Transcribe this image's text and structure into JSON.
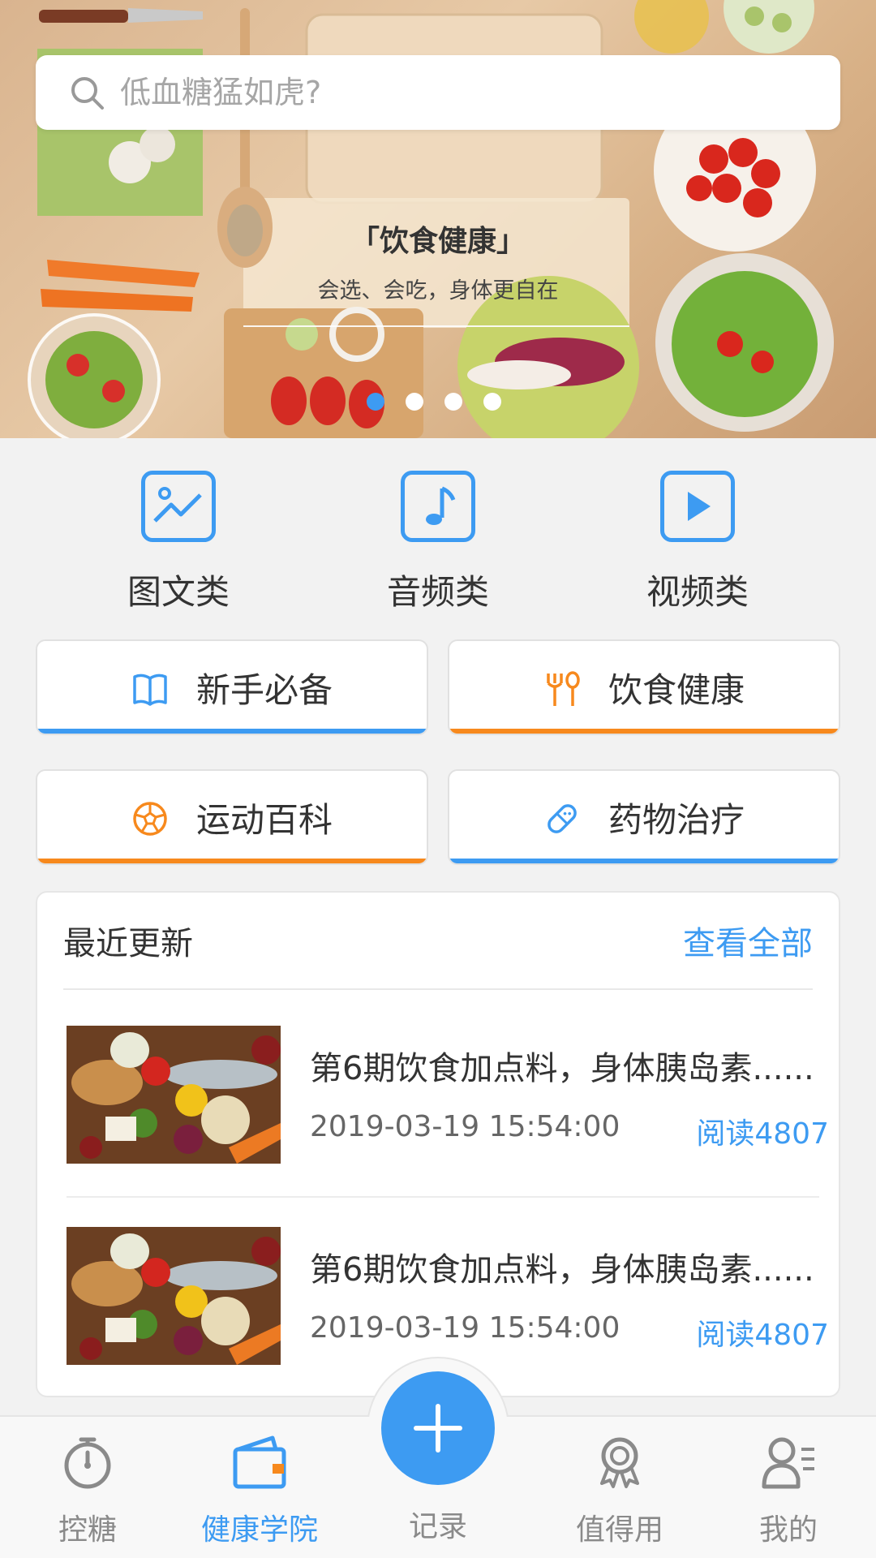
{
  "search": {
    "placeholder": "低血糖猛如虎?"
  },
  "banner": {
    "title": "「饮食健康」",
    "subtitle": "会选、会吃，身体更自在",
    "dots": 4,
    "active_dot": 0
  },
  "categories": [
    {
      "label": "图文类",
      "icon": "image-chart-icon"
    },
    {
      "label": "音频类",
      "icon": "music-note-icon"
    },
    {
      "label": "视频类",
      "icon": "play-icon"
    }
  ],
  "tiles": [
    {
      "label": "新手必备",
      "icon": "book-icon",
      "accent": "#3d9bf2"
    },
    {
      "label": "饮食健康",
      "icon": "fork-spoon-icon",
      "accent": "#f7891d"
    },
    {
      "label": "运动百科",
      "icon": "ball-icon",
      "accent": "#f7891d"
    },
    {
      "label": "药物治疗",
      "icon": "pill-icon",
      "accent": "#3d9bf2"
    }
  ],
  "recent": {
    "title": "最近更新",
    "more": "查看全部",
    "items": [
      {
        "title": "第6期饮食加点料，身体胰岛素......",
        "date": "2019-03-19  15:54:00",
        "reads": "阅读4807"
      },
      {
        "title": "第6期饮食加点料，身体胰岛素......",
        "date": "2019-03-19  15:54:00",
        "reads": "阅读4807"
      }
    ]
  },
  "nav": {
    "items": [
      {
        "label": "控糖",
        "icon": "stopwatch-icon"
      },
      {
        "label": "健康学院",
        "icon": "wallet-icon",
        "active": true
      },
      {
        "label": "记录",
        "icon": "plus-icon"
      },
      {
        "label": "值得用",
        "icon": "award-icon"
      },
      {
        "label": "我的",
        "icon": "user-list-icon"
      }
    ]
  },
  "colors": {
    "primary": "#3d9bf2",
    "accent": "#f7891d"
  }
}
